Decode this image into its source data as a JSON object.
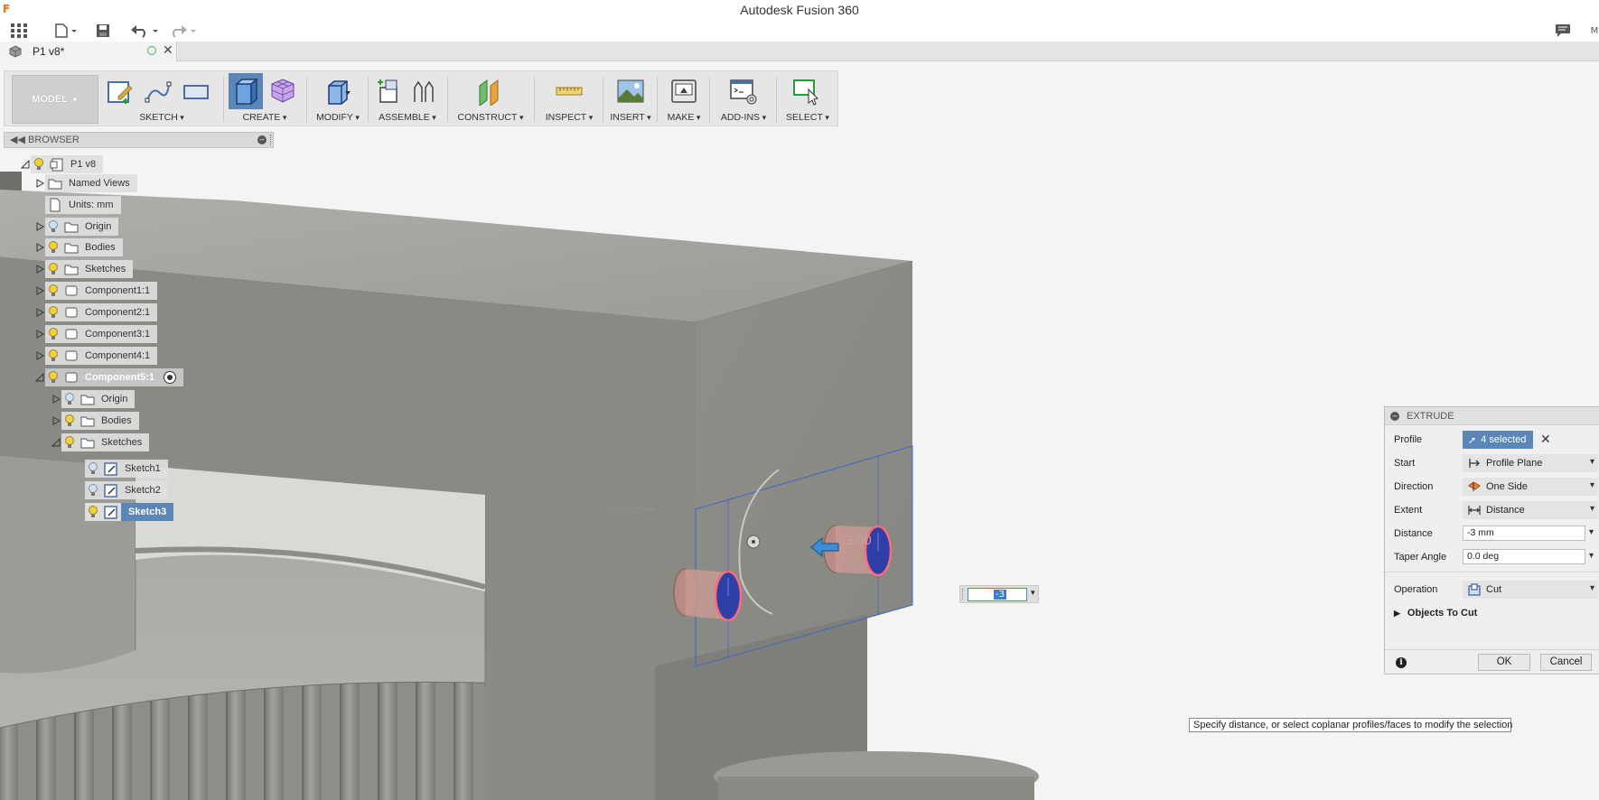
{
  "window": {
    "title": "Autodesk Fusion 360",
    "logo_letter": "F",
    "accent": "#e8751a"
  },
  "quick_access": {
    "icons": [
      "apps-grid-icon",
      "file-icon",
      "save-icon",
      "undo-icon",
      "redo-icon",
      "comments-icon"
    ],
    "right_letter": "M"
  },
  "document_tab": {
    "label": "P1 v8*",
    "close": "✕"
  },
  "toolbar": {
    "workspace": "MODEL",
    "groups": [
      {
        "label": "SKETCH"
      },
      {
        "label": "CREATE"
      },
      {
        "label": "MODIFY"
      },
      {
        "label": "ASSEMBLE"
      },
      {
        "label": "CONSTRUCT"
      },
      {
        "label": "INSPECT"
      },
      {
        "label": "INSERT"
      },
      {
        "label": "MAKE"
      },
      {
        "label": "ADD-INS"
      },
      {
        "label": "SELECT"
      }
    ]
  },
  "browser": {
    "title": "BROWSER",
    "nodes": [
      {
        "label": "P1 v8"
      },
      {
        "label": "Named Views"
      },
      {
        "label": "Units: mm"
      },
      {
        "label": "Origin"
      },
      {
        "label": "Bodies"
      },
      {
        "label": "Sketches"
      },
      {
        "label": "Component1:1"
      },
      {
        "label": "Component2:1"
      },
      {
        "label": "Component3:1"
      },
      {
        "label": "Component4:1"
      },
      {
        "label": "Component5:1"
      },
      {
        "label": "Origin"
      },
      {
        "label": "Bodies"
      },
      {
        "label": "Sketches"
      },
      {
        "label": "Sketch1"
      },
      {
        "label": "Sketch2"
      },
      {
        "label": "Sketch3"
      }
    ]
  },
  "extrude": {
    "title": "EXTRUDE",
    "profile": {
      "label": "Profile",
      "value": "4 selected"
    },
    "start": {
      "label": "Start",
      "value": "Profile Plane"
    },
    "direction": {
      "label": "Direction",
      "value": "One Side"
    },
    "extent": {
      "label": "Extent",
      "value": "Distance"
    },
    "distance": {
      "label": "Distance",
      "value": "-3 mm"
    },
    "taper": {
      "label": "Taper Angle",
      "value": "0.0 deg"
    },
    "operation": {
      "label": "Operation",
      "value": "Cut"
    },
    "objects_to_cut": "Objects To Cut",
    "ok": "OK",
    "cancel": "Cancel"
  },
  "hud": {
    "value": "-3",
    "ghost_value": "3.00"
  },
  "status_tip": "Specify distance, or select coplanar profiles/faces to modify the selection",
  "colors": {
    "selection_blue": "#5b86b8",
    "profile_red": "#e0455a",
    "model_gray": "#8c8c86"
  }
}
